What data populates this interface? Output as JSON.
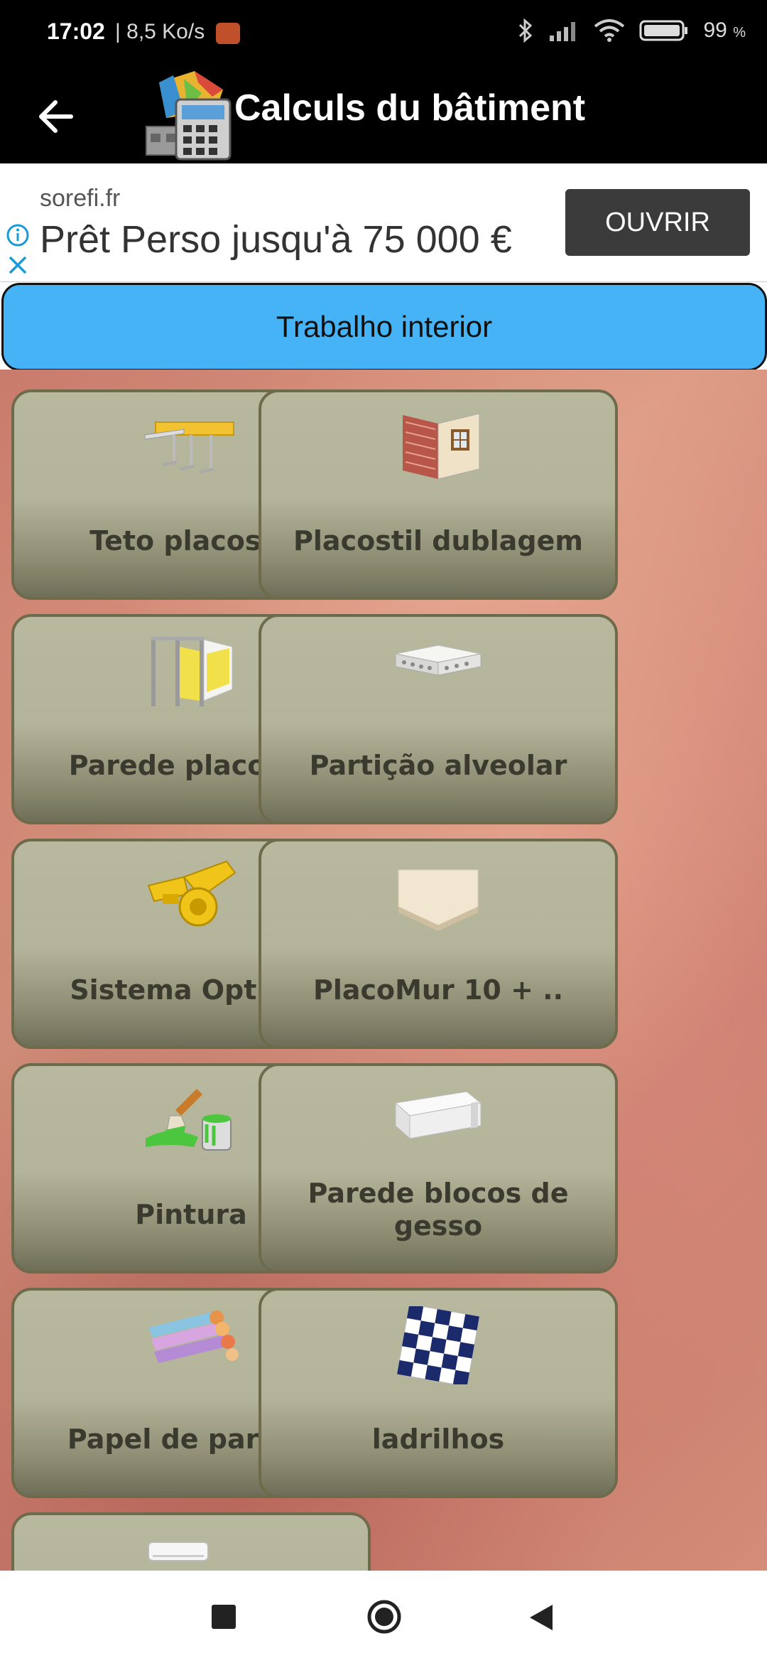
{
  "status_bar": {
    "time": "17:02",
    "speed": "| 8,5 Ko/s",
    "battery": "99",
    "battery_unit": "%"
  },
  "app_bar": {
    "title": "Calculs du bâtiment",
    "back_icon": "arrow-left-icon"
  },
  "ad": {
    "domain": "sorefi.fr",
    "headline": "Prêt Perso jusqu'à 75 000 €",
    "button_label": "OUVRIR"
  },
  "section": {
    "title": "Trabalho interior",
    "color": "#45b3f6"
  },
  "tiles": [
    {
      "label": "Teto placostil",
      "icon": "ceiling-rail-icon"
    },
    {
      "label": "Placostil dublagem",
      "icon": "wall-lining-icon"
    },
    {
      "label": "Parede placostil",
      "icon": "partition-wall-icon"
    },
    {
      "label": "Partição alveolar",
      "icon": "honeycomb-panel-icon"
    },
    {
      "label": "Sistema Optima",
      "icon": "optima-clip-icon"
    },
    {
      "label": "PlacoMur 10 + ..",
      "icon": "insulated-board-icon"
    },
    {
      "label": "Pintura",
      "icon": "paint-brush-icon"
    },
    {
      "label": "Parede blocos de",
      "label2": "gesso",
      "icon": "plaster-block-icon"
    },
    {
      "label": "Papel de parede",
      "icon": "wallpaper-roll-icon"
    },
    {
      "label": "ladrilhos",
      "icon": "tiles-icon"
    },
    {
      "label": "",
      "icon": "air-conditioner-icon"
    }
  ],
  "nav": {
    "recent": "recent-apps-icon",
    "home": "home-icon",
    "back": "back-icon"
  }
}
